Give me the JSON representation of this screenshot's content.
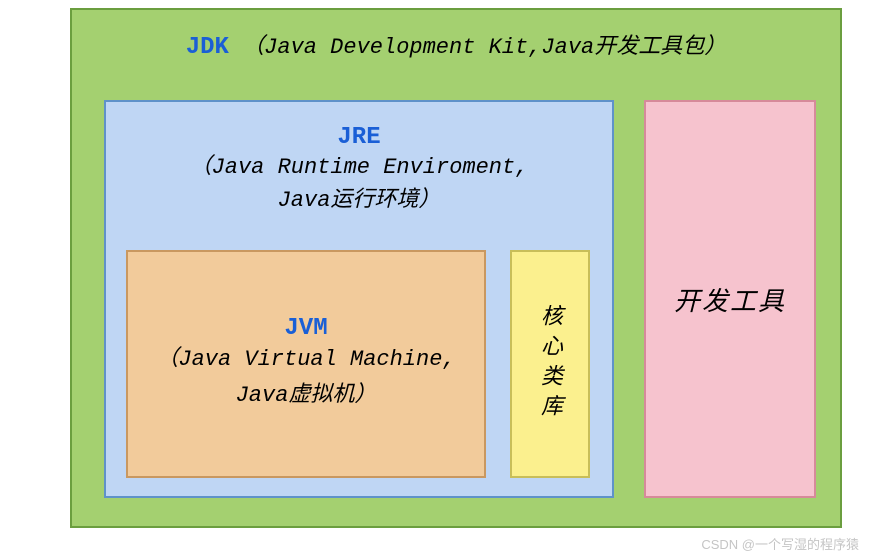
{
  "jdk": {
    "label": "JDK",
    "desc": "（Java Development Kit,Java开发工具包）"
  },
  "jre": {
    "label": "JRE",
    "desc_line1": "（Java Runtime Enviroment,",
    "desc_line2": "Java运行环境）"
  },
  "jvm": {
    "label": "JVM",
    "desc_line1": "（Java Virtual Machine,",
    "desc_line2": "Java虚拟机）"
  },
  "corelib": {
    "label": "核心类库"
  },
  "devtools": {
    "label": "开发工具"
  },
  "watermark": "CSDN @一个写湿的程序猿",
  "colors": {
    "jdk_bg": "#a4d070",
    "jre_bg": "#bfd6f4",
    "jvm_bg": "#f2cb9b",
    "corelib_bg": "#fbf08e",
    "devtools_bg": "#f6c3ce",
    "label_blue": "#1a5fd6"
  }
}
